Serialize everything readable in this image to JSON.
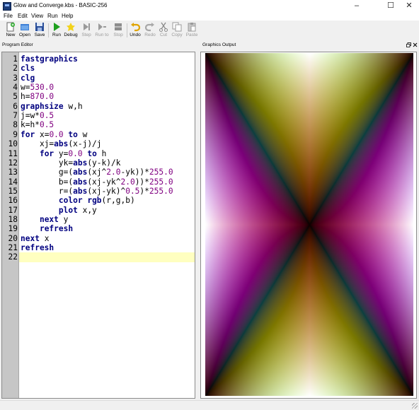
{
  "window": {
    "title": "Glow and Converge.kbs - BASIC-256",
    "minimize": "–",
    "maximize": "☐",
    "close": "✕"
  },
  "menu": [
    "File",
    "Edit",
    "View",
    "Run",
    "Help"
  ],
  "toolbar": [
    {
      "label": "New",
      "icon": "new-icon",
      "enabled": true
    },
    {
      "label": "Open",
      "icon": "open-icon",
      "enabled": true
    },
    {
      "label": "Save",
      "icon": "save-icon",
      "enabled": true
    },
    {
      "label": "Run",
      "icon": "run-icon",
      "enabled": true
    },
    {
      "label": "Debug",
      "icon": "debug-icon",
      "enabled": true
    },
    {
      "label": "Step",
      "icon": "step-icon",
      "enabled": false
    },
    {
      "label": "Run to",
      "icon": "run-to-icon",
      "enabled": false
    },
    {
      "label": "Stop",
      "icon": "stop-icon",
      "enabled": false
    },
    {
      "label": "Undo",
      "icon": "undo-icon",
      "enabled": true
    },
    {
      "label": "Redo",
      "icon": "redo-icon",
      "enabled": false
    },
    {
      "label": "Cut",
      "icon": "cut-icon",
      "enabled": false
    },
    {
      "label": "Copy",
      "icon": "copy-icon",
      "enabled": false
    },
    {
      "label": "Paste",
      "icon": "paste-icon",
      "enabled": false
    }
  ],
  "editor": {
    "title": "Program Editor",
    "current_line": 22,
    "lines": [
      [
        {
          "t": "fastgraphics",
          "c": "kw"
        }
      ],
      [
        {
          "t": "cls",
          "c": "kw"
        }
      ],
      [
        {
          "t": "clg",
          "c": "kw"
        }
      ],
      [
        {
          "t": "w="
        },
        {
          "t": "530.0",
          "c": "num"
        }
      ],
      [
        {
          "t": "h="
        },
        {
          "t": "870.0",
          "c": "num"
        }
      ],
      [
        {
          "t": "graphsize",
          "c": "kw"
        },
        {
          "t": " w,h"
        }
      ],
      [
        {
          "t": "j=w*"
        },
        {
          "t": "0.5",
          "c": "num"
        }
      ],
      [
        {
          "t": "k=h*"
        },
        {
          "t": "0.5",
          "c": "num"
        }
      ],
      [
        {
          "t": "for",
          "c": "kw"
        },
        {
          "t": " x="
        },
        {
          "t": "0.0",
          "c": "num"
        },
        {
          "t": " "
        },
        {
          "t": "to",
          "c": "kw"
        },
        {
          "t": " w"
        }
      ],
      [
        {
          "t": "    xj="
        },
        {
          "t": "abs",
          "c": "kw"
        },
        {
          "t": "(x-j)/j"
        }
      ],
      [
        {
          "t": "    "
        },
        {
          "t": "for",
          "c": "kw"
        },
        {
          "t": " y="
        },
        {
          "t": "0.0",
          "c": "num"
        },
        {
          "t": " "
        },
        {
          "t": "to",
          "c": "kw"
        },
        {
          "t": " h"
        }
      ],
      [
        {
          "t": "        yk="
        },
        {
          "t": "abs",
          "c": "kw"
        },
        {
          "t": "(y-k)/k"
        }
      ],
      [
        {
          "t": "        g=("
        },
        {
          "t": "abs",
          "c": "kw"
        },
        {
          "t": "(xj^"
        },
        {
          "t": "2.0",
          "c": "num"
        },
        {
          "t": "-yk))*"
        },
        {
          "t": "255.0",
          "c": "num"
        }
      ],
      [
        {
          "t": "        b=("
        },
        {
          "t": "abs",
          "c": "kw"
        },
        {
          "t": "(xj-yk^"
        },
        {
          "t": "2.0",
          "c": "num"
        },
        {
          "t": "))*"
        },
        {
          "t": "255.0",
          "c": "num"
        }
      ],
      [
        {
          "t": "        r=("
        },
        {
          "t": "abs",
          "c": "kw"
        },
        {
          "t": "(xj-yk)^"
        },
        {
          "t": "0.5",
          "c": "num"
        },
        {
          "t": ")*"
        },
        {
          "t": "255.0",
          "c": "num"
        }
      ],
      [
        {
          "t": "        "
        },
        {
          "t": "color",
          "c": "kw"
        },
        {
          "t": " "
        },
        {
          "t": "rgb",
          "c": "kw"
        },
        {
          "t": "(r,g,b)"
        }
      ],
      [
        {
          "t": "        "
        },
        {
          "t": "plot",
          "c": "kw"
        },
        {
          "t": " x,y"
        }
      ],
      [
        {
          "t": "    "
        },
        {
          "t": "next",
          "c": "kw"
        },
        {
          "t": " y"
        }
      ],
      [
        {
          "t": "    "
        },
        {
          "t": "refresh",
          "c": "kw"
        }
      ],
      [
        {
          "t": "next",
          "c": "kw"
        },
        {
          "t": " x"
        }
      ],
      [
        {
          "t": "refresh",
          "c": "kw"
        }
      ],
      []
    ]
  },
  "graphics": {
    "title": "Graphics Output",
    "float_icon": "restore-window-icon",
    "close_icon": "close-icon"
  }
}
